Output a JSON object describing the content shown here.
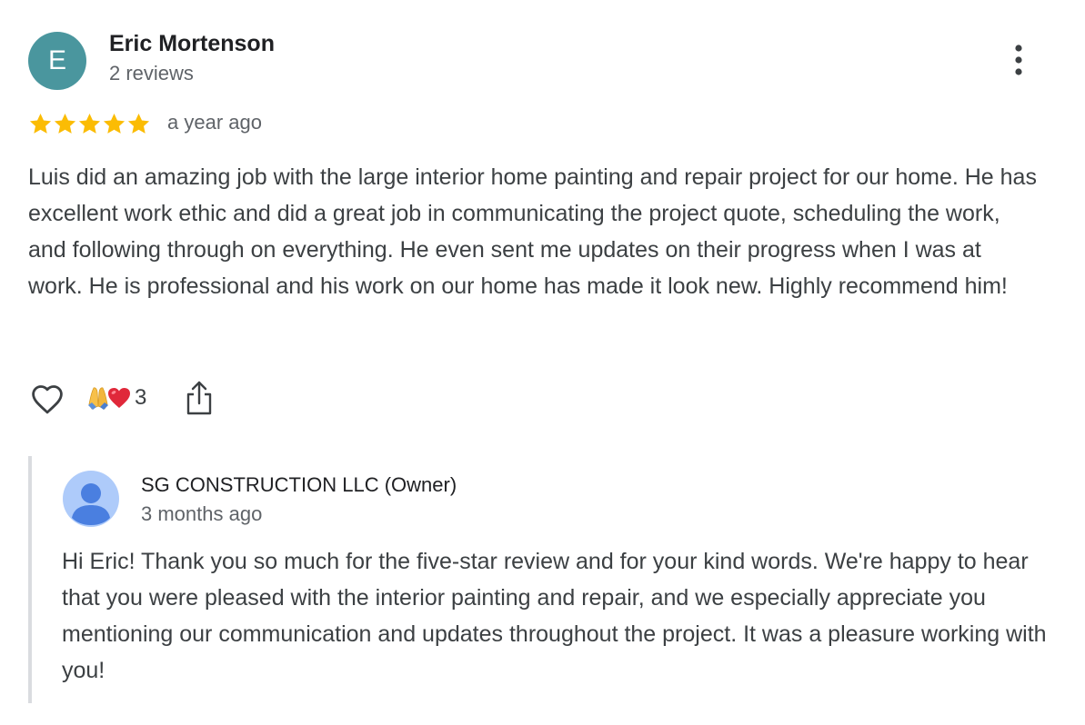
{
  "review": {
    "avatar_letter": "E",
    "reviewer_name": "Eric Mortenson",
    "review_count": "2 reviews",
    "rating": 5,
    "rating_max": 5,
    "time": "a year ago",
    "text": "Luis did an amazing job with the large interior home painting and repair project for our home. He has excellent work ethic and did a great job in communicating the project quote, scheduling the work, and following through on everything. He even sent me updates on their progress when I was at work. He is professional and his work on our home has made it look new. Highly recommend him!",
    "reaction_count": "3",
    "icons": [
      "more-vert-icon",
      "heart-outline-icon",
      "pray-emoji-icon",
      "red-heart-emoji-icon",
      "share-icon",
      "star-icon"
    ]
  },
  "reply": {
    "owner_name": "SG CONSTRUCTION LLC (Owner)",
    "time": "3 months ago",
    "text": "Hi Eric! Thank you so much for the five-star review and for your kind words. We're happy to hear that you were pleased with the interior painting and repair, and we especially appreciate you mentioning our communication and updates throughout the project. It was a pleasure working with you!"
  },
  "colors": {
    "avatar_bg": "#4a969e",
    "star": "#fbbc04",
    "owner_avatar_bg": "#aecbfa",
    "owner_avatar_fg": "#4a7fe0",
    "reply_border": "#dadce0"
  }
}
